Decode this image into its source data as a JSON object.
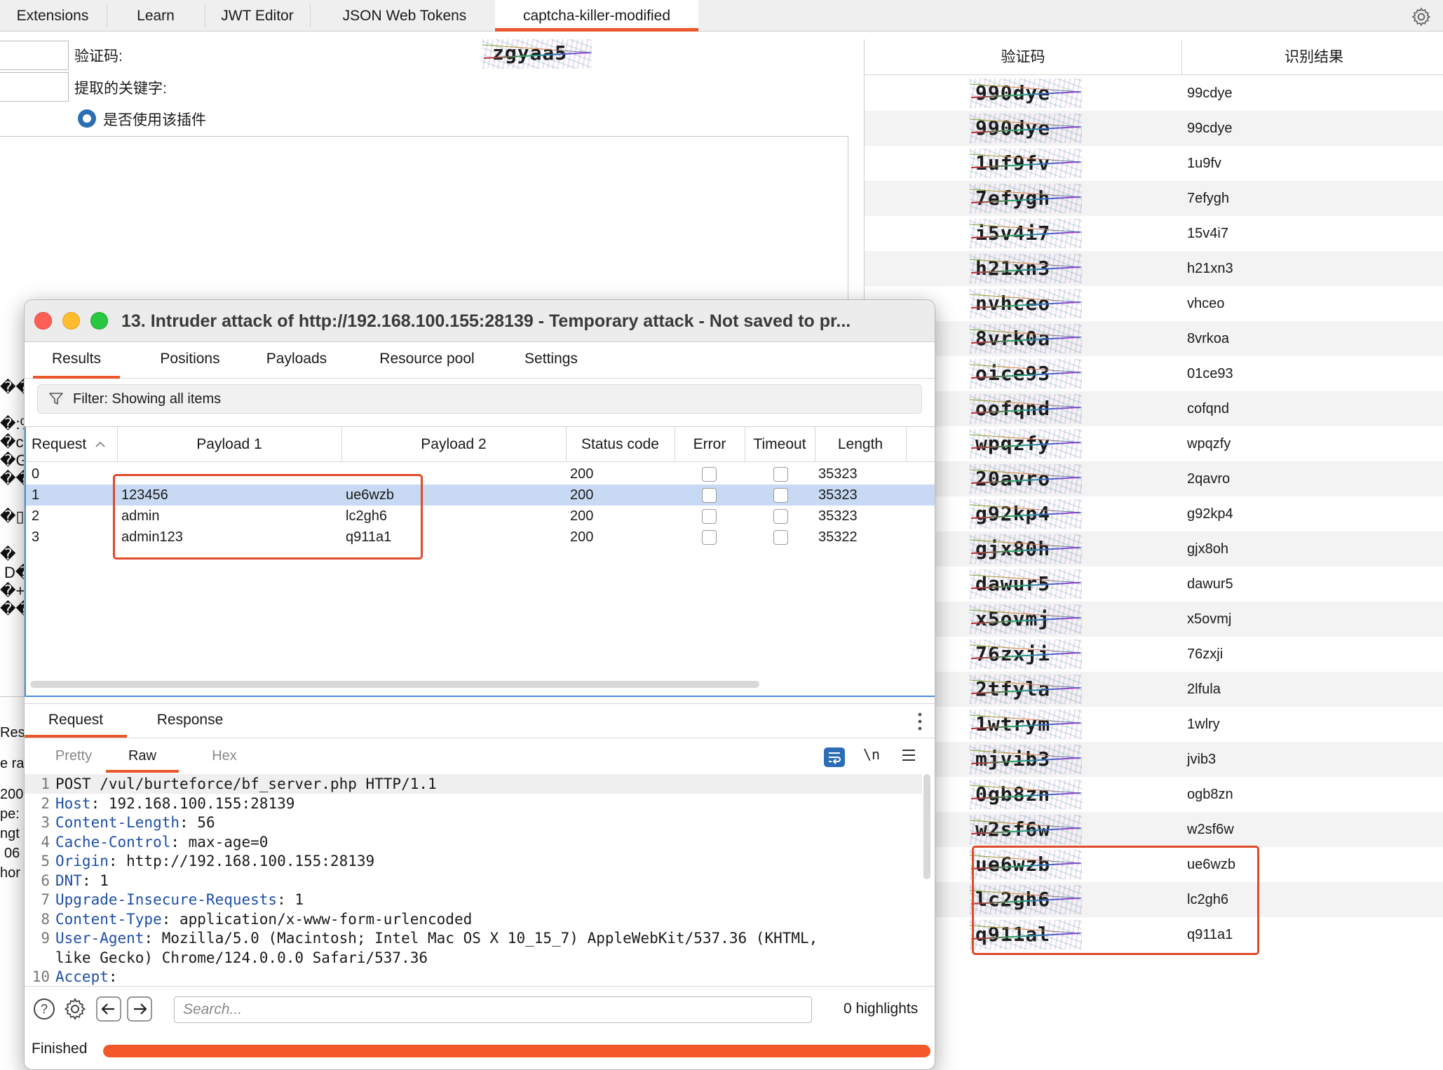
{
  "top_tabs": [
    {
      "label": "Extensions"
    },
    {
      "label": "Learn"
    },
    {
      "label": "JWT Editor"
    },
    {
      "label": "JSON Web Tokens"
    },
    {
      "label": "captcha-killer-modified",
      "active": true
    }
  ],
  "plugin": {
    "captcha_label": "验证码:",
    "keyword_label": "提取的关键字:",
    "use_plugin_label": "是否使用该插件",
    "use_plugin_checked": true,
    "current_captcha": "zgyaa5",
    "left_garble": [
      "��",
      "�:%",
      "�c�",
      "�G�",
      "��",
      "�▯",
      "�",
      "D�",
      "�+",
      "��",
      "Res",
      "e ra",
      "200",
      "pe:",
      "ngt",
      "06",
      "hor"
    ]
  },
  "recognition_table": {
    "headers": [
      "验证码",
      "识别结果"
    ],
    "rows": [
      {
        "captcha": "990dye",
        "result": "99cdye"
      },
      {
        "captcha": "990dye",
        "result": "99cdye"
      },
      {
        "captcha": "1uf9fv",
        "result": "1u9fv"
      },
      {
        "captcha": "7efygh",
        "result": "7efygh"
      },
      {
        "captcha": "i5v4i7",
        "result": "15v4i7"
      },
      {
        "captcha": "h21xn3",
        "result": "h21xn3"
      },
      {
        "captcha": "nvhceo",
        "result": "vhceo"
      },
      {
        "captcha": "8vrk0a",
        "result": "8vrkoa"
      },
      {
        "captcha": "oice93",
        "result": "01ce93"
      },
      {
        "captcha": "oofqnd",
        "result": "cofqnd"
      },
      {
        "captcha": "wpqzfy",
        "result": "wpqzfy"
      },
      {
        "captcha": "20avro",
        "result": "2qavro"
      },
      {
        "captcha": "g92kp4",
        "result": "g92kp4"
      },
      {
        "captcha": "gjx80h",
        "result": "gjx8oh"
      },
      {
        "captcha": "dawur5",
        "result": "dawur5"
      },
      {
        "captcha": "x5ovmj",
        "result": "x5ovmj"
      },
      {
        "captcha": "76zxji",
        "result": "76zxji"
      },
      {
        "captcha": "2tfyla",
        "result": "2lfula"
      },
      {
        "captcha": "1wtrym",
        "result": "1wlry"
      },
      {
        "captcha": "mjvib3",
        "result": "jvib3"
      },
      {
        "captcha": "0gb8zn",
        "result": "ogb8zn"
      },
      {
        "captcha": "w2sf6w",
        "result": "w2sf6w"
      },
      {
        "captcha": "ue6wzb",
        "result": "ue6wzb"
      },
      {
        "captcha": "lc2gh6",
        "result": "lc2gh6"
      },
      {
        "captcha": "q911al",
        "result": "q911a1"
      }
    ]
  },
  "intruder": {
    "title": "13. Intruder attack of http://192.168.100.155:28139 - Temporary attack - Not saved to pr...",
    "tabs": [
      "Results",
      "Positions",
      "Payloads",
      "Resource pool",
      "Settings"
    ],
    "filter_text": "Filter: Showing all items",
    "columns": [
      "Request",
      "Payload 1",
      "Payload 2",
      "Status code",
      "Error",
      "Timeout",
      "Length"
    ],
    "rows": [
      {
        "request": "0",
        "payload1": "",
        "payload2": "",
        "status": "200",
        "length": "35323",
        "selected": false
      },
      {
        "request": "1",
        "payload1": "123456",
        "payload2": "ue6wzb",
        "status": "200",
        "length": "35323",
        "selected": true
      },
      {
        "request": "2",
        "payload1": "admin",
        "payload2": "lc2gh6",
        "status": "200",
        "length": "35323",
        "selected": false
      },
      {
        "request": "3",
        "payload1": "admin123",
        "payload2": "q911a1",
        "status": "200",
        "length": "35322",
        "selected": false
      }
    ],
    "editor_tabs": [
      "Request",
      "Response"
    ],
    "view_tabs": [
      "Pretty",
      "Raw",
      "Hex"
    ],
    "newline_toggle": "\\n",
    "request_lines": [
      {
        "num": "1",
        "name": "",
        "value": "POST /vul/burteforce/bf_server.php HTTP/1.1"
      },
      {
        "num": "2",
        "name": "Host",
        "value": ": 192.168.100.155:28139"
      },
      {
        "num": "3",
        "name": "Content-Length",
        "value": ": 56"
      },
      {
        "num": "4",
        "name": "Cache-Control",
        "value": ": max-age=0"
      },
      {
        "num": "5",
        "name": "Origin",
        "value": ": http://192.168.100.155:28139"
      },
      {
        "num": "6",
        "name": "DNT",
        "value": ": 1"
      },
      {
        "num": "7",
        "name": "Upgrade-Insecure-Requests",
        "value": ": 1"
      },
      {
        "num": "8",
        "name": "Content-Type",
        "value": ": application/x-www-form-urlencoded"
      },
      {
        "num": "9",
        "name": "User-Agent",
        "value": ": Mozilla/5.0 (Macintosh; Intel Mac OS X 10_15_7) AppleWebKit/537.36 (KHTML,"
      },
      {
        "num": "",
        "name": "",
        "value": "like Gecko) Chrome/124.0.0.0 Safari/537.36"
      },
      {
        "num": "10",
        "name": "Accept",
        "value": ":"
      }
    ],
    "search_placeholder": "Search...",
    "highlights": "0 highlights",
    "status": "Finished",
    "progress_fraction": 1.0
  },
  "colors": {
    "accent": "#e9572b",
    "selection": "#c8daf3",
    "header_name": "#1e4fa3",
    "highlight_box": "#e04a2a"
  }
}
